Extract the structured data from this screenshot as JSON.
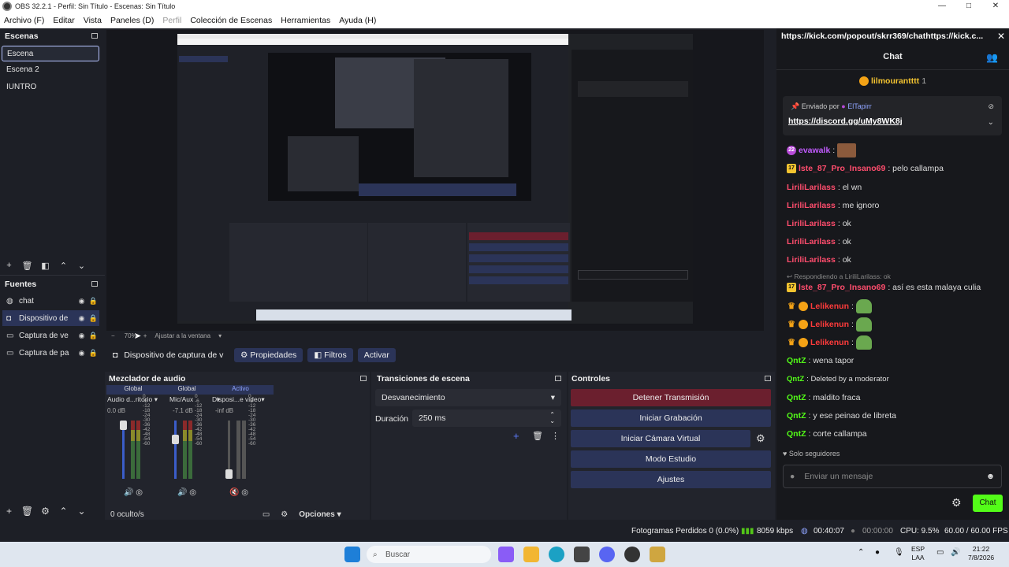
{
  "window": {
    "title": "OBS 32.2.1 - Perfil: Sin Título - Escenas: Sin Título",
    "controls": [
      "—",
      "□",
      "✕"
    ]
  },
  "menu": [
    "Archivo (F)",
    "Editar",
    "Vista",
    "Paneles (D)",
    "Perfil",
    "Colección de Escenas",
    "Herramientas",
    "Ayuda (H)"
  ],
  "scenes": {
    "header": "Escenas",
    "items": [
      "Escena",
      "Escena 2",
      "IUNTRO"
    ]
  },
  "sources": {
    "header": "Fuentes",
    "items": [
      {
        "label": "chat",
        "icon": "globe-icon"
      },
      {
        "label": "Dispositivo de",
        "icon": "camera-icon"
      },
      {
        "label": "Captura de ve",
        "icon": "window-icon"
      },
      {
        "label": "Captura de pa",
        "icon": "monitor-icon"
      }
    ]
  },
  "zoom": {
    "value": "70%",
    "fit": "Ajustar a la ventana"
  },
  "propbar": {
    "source": "Dispositivo de captura de v",
    "properties": "Propiedades",
    "filters": "Filtros",
    "activate": "Activar"
  },
  "mixer": {
    "header": "Mezclador de audio",
    "tabs": [
      "Global",
      "Global",
      "Activo"
    ],
    "channels": [
      {
        "name": "Audio d...ritorio",
        "db": "0.0 dB",
        "level": 0.85
      },
      {
        "name": "Mic/Aux",
        "db": "-7.1 dB",
        "level": 0.72
      },
      {
        "name": "Disposi...e video",
        "db": "-inf dB",
        "level": 0.1
      }
    ],
    "scale": [
      "0",
      "-6",
      "-12",
      "-18",
      "-24",
      "-30",
      "-36",
      "-42",
      "-48",
      "-54",
      "-60"
    ],
    "hidden": "0 oculto/s",
    "options": "Opciones"
  },
  "transitions": {
    "header": "Transiciones de escena",
    "type": "Desvanecimiento",
    "duration_label": "Duración",
    "duration_value": "250 ms"
  },
  "controls": {
    "header": "Controles",
    "buttons": [
      "Detener Transmisión",
      "Iniciar Grabación",
      "Iniciar Cámara Virtual",
      "Modo Estudio",
      "Ajustes"
    ]
  },
  "chat": {
    "url": "https://kick.com/popout/skrr369/chathttps://kick.c...",
    "title": "Chat",
    "top_user": "lilmourantttt",
    "top_count": "1",
    "pinned_by_label": "Enviado por",
    "pinned_by_user": "ElTapirr",
    "pinned_link": "https://discord.gg/uMy8WK8j",
    "messages": [
      {
        "user": "evawalk",
        "text": ":",
        "color": "#c25bff",
        "badge": "22"
      },
      {
        "user": "lste_87_Pro_Insano69",
        "text": ": pelo callampa",
        "color": "#ff4d6d",
        "badge": "17"
      },
      {
        "user": "LiriliLarilass",
        "text": ": el wn",
        "color": "#ff4d6d",
        "badge": ""
      },
      {
        "user": "LiriliLarilass",
        "text": ": me ignoro",
        "color": "#ff4d6d",
        "badge": ""
      },
      {
        "user": "LiriliLarilass",
        "text": ": ok",
        "color": "#ff4d6d",
        "badge": ""
      },
      {
        "user": "LiriliLarilass",
        "text": ": ok",
        "color": "#ff4d6d",
        "badge": ""
      },
      {
        "user": "LiriliLarilass",
        "text": ": ok",
        "color": "#ff4d6d",
        "badge": ""
      }
    ],
    "replying_to": "Respondiendo a LiriliLarilass: ok",
    "reply_msg": {
      "user": "lste_87_Pro_Insano69",
      "text": ": así es esta malaya culia",
      "badge": "17"
    },
    "lelikenun": [
      "Lelikenun",
      "Lelikenun",
      "Lelikenun"
    ],
    "qntz": [
      {
        "user": "QntZ",
        "text": ": wena tapor"
      },
      {
        "user": "QntZ",
        "text": ": Deleted by a moderator"
      },
      {
        "user": "QntZ",
        "text": ": maldito fraca"
      },
      {
        "user": "QntZ",
        "text": ": y ese peinao de libreta"
      },
      {
        "user": "QntZ",
        "text": ": corte callampa"
      }
    ],
    "followers_only": "Solo seguidores",
    "input_placeholder": "Enviar un mensaje",
    "send": "Chat"
  },
  "status": {
    "dropped": "Fotogramas Perdidos 0 (0.0%)",
    "bitrate": "8059 kbps",
    "stream_time": "00:40:07",
    "rec_time": "00:00:00",
    "cpu": "CPU: 9.5%",
    "fps": "60.00 / 60.00 FPS"
  },
  "taskbar": {
    "search": "Buscar",
    "lang1": "ESP",
    "lang2": "LAA",
    "time": "21:22",
    "date": "7/8/2026"
  }
}
